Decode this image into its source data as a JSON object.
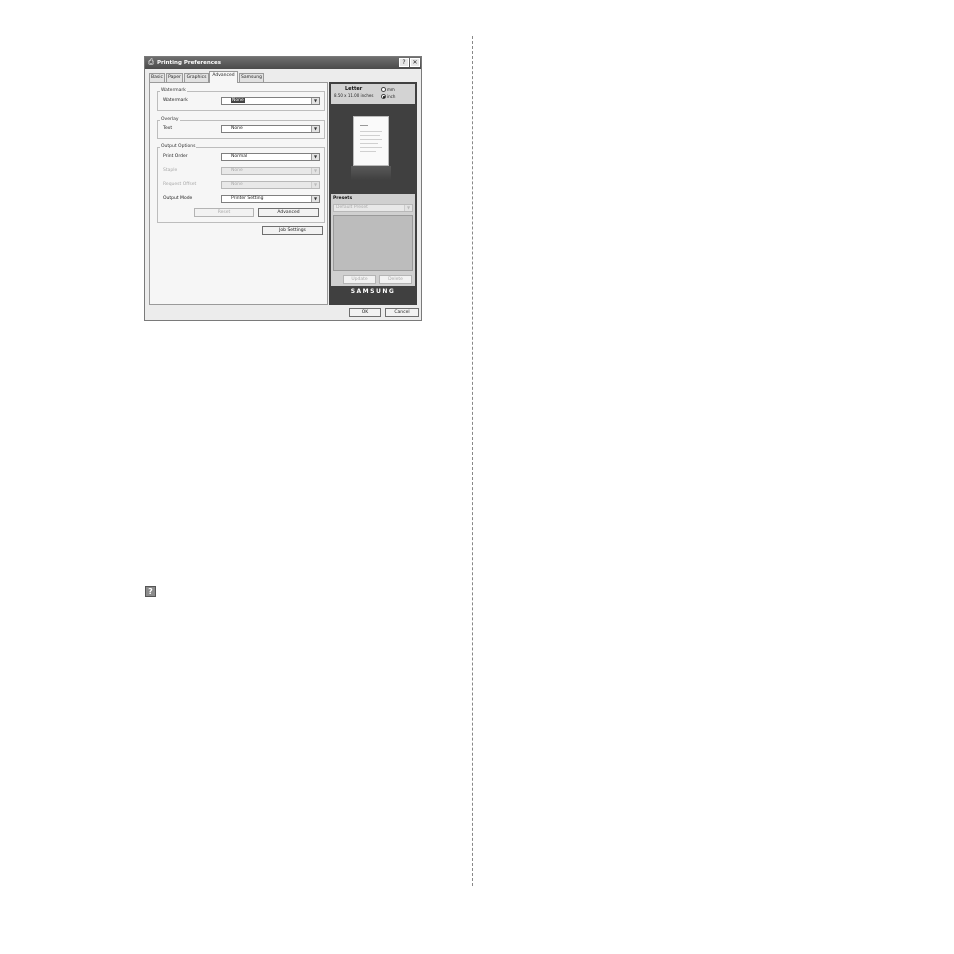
{
  "dialog": {
    "title": "Printing Preferences",
    "tabs": [
      {
        "label": "Basic"
      },
      {
        "label": "Paper"
      },
      {
        "label": "Graphics"
      },
      {
        "label": "Advanced",
        "active": true
      },
      {
        "label": "Samsung"
      }
    ],
    "watermark": {
      "group_label": "Watermark",
      "field_label": "Watermark",
      "value": "None"
    },
    "overlay": {
      "group_label": "Overlay",
      "field_label": "Text",
      "value": "None"
    },
    "output_options": {
      "group_label": "Output Options",
      "print_order": {
        "label": "Print Order",
        "value": "Normal"
      },
      "staple": {
        "label": "Staple",
        "value": "None",
        "disabled": true
      },
      "request_offset": {
        "label": "Request Offset",
        "value": "None",
        "disabled": true
      },
      "output_mode": {
        "label": "Output Mode",
        "value": "Printer Setting"
      },
      "reset_label": "Reset",
      "advanced_label": "Advanced"
    },
    "job_settings_label": "Job Settings",
    "preview": {
      "paper_size": "Letter",
      "dimensions": "8.50 x 11.00 inches",
      "unit_mm": "mm",
      "unit_inch": "inch",
      "selected_unit": "inch"
    },
    "presets": {
      "label": "Presets",
      "value": "Default Preset",
      "update_label": "Update",
      "delete_label": "Delete"
    },
    "brand": "SAMSUNG",
    "ok_label": "OK",
    "cancel_label": "Cancel"
  },
  "icons": {
    "app": "printer-icon",
    "help": "help-icon",
    "close": "close-icon",
    "dropdown": "chevron-down-icon"
  },
  "doc": {
    "help_icon_glyph": "?"
  }
}
